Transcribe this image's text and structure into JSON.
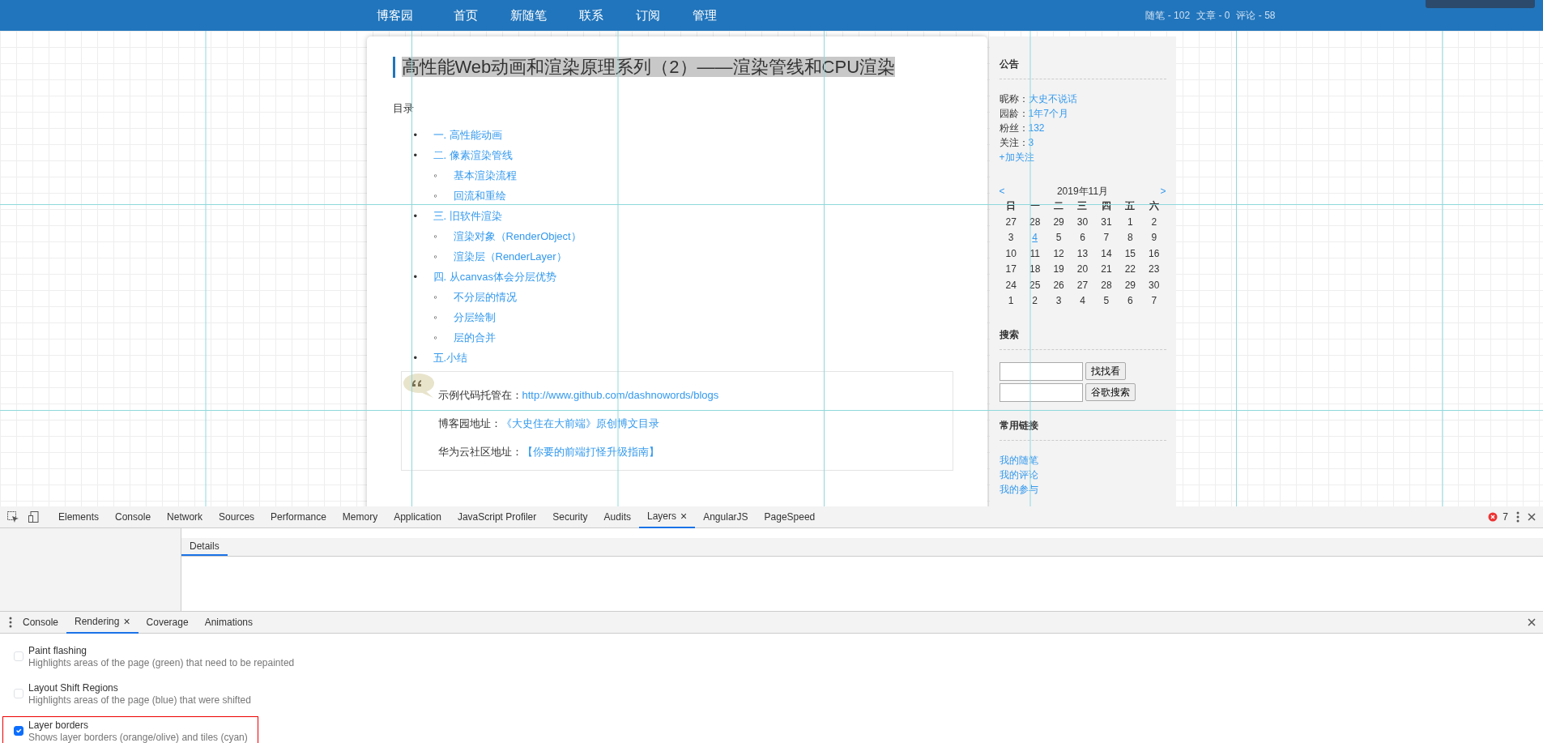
{
  "site_nav": {
    "brand": "博客园",
    "links": [
      "首页",
      "新随笔",
      "联系",
      "订阅",
      "管理"
    ],
    "stats": [
      "随笔 - 102",
      "文章 - 0",
      "评论 - 58"
    ]
  },
  "article": {
    "title": "高性能Web动画和渲染原理系列（2）——渲染管线和CPU渲染",
    "toc_label": "目录",
    "toc": [
      {
        "marker": "•",
        "text": "一. 高性能动画"
      },
      {
        "marker": "•",
        "text": "二. 像素渲染管线",
        "children": [
          {
            "marker": "◦",
            "text": "基本渲染流程"
          },
          {
            "marker": "◦",
            "text": "回流和重绘"
          }
        ]
      },
      {
        "marker": "•",
        "text": "三. 旧软件渲染",
        "children": [
          {
            "marker": "◦",
            "text": "渲染对象（RenderObject）"
          },
          {
            "marker": "◦",
            "text": "渲染层（RenderLayer）"
          }
        ]
      },
      {
        "marker": "•",
        "text": "四. 从canvas体会分层优势",
        "children": [
          {
            "marker": "◦",
            "text": "不分层的情况"
          },
          {
            "marker": "◦",
            "text": "分层绘制"
          },
          {
            "marker": "◦",
            "text": "层的合并"
          }
        ]
      },
      {
        "marker": "•",
        "text": "五.小结"
      }
    ],
    "quote": [
      {
        "label": "示例代码托管在：",
        "link": "http://www.github.com/dashnowords/blogs"
      },
      {
        "label": "博客园地址：",
        "link": "《大史住在大前端》原创博文目录"
      },
      {
        "label": "华为云社区地址：",
        "link": "【你要的前端打怪升级指南】"
      }
    ]
  },
  "sidebar": {
    "notice_heading": "公告",
    "profile": [
      {
        "label": "昵称：",
        "value": "大史不说话"
      },
      {
        "label": "园龄：",
        "value": "1年7个月"
      },
      {
        "label": "粉丝：",
        "value": "132"
      },
      {
        "label": "关注：",
        "value": "3"
      }
    ],
    "follow": "+加关注",
    "calendar": {
      "title": "2019年11月",
      "prev": "<",
      "next": ">",
      "weekdays": [
        "日",
        "一",
        "二",
        "三",
        "四",
        "五",
        "六"
      ],
      "weeks": [
        [
          {
            "day": "27",
            "linked": false
          },
          {
            "day": "28",
            "linked": false
          },
          {
            "day": "29",
            "linked": false
          },
          {
            "day": "30",
            "linked": false
          },
          {
            "day": "31",
            "linked": false
          },
          {
            "day": "1",
            "linked": false
          },
          {
            "day": "2",
            "linked": false
          }
        ],
        [
          {
            "day": "3",
            "linked": false
          },
          {
            "day": "4",
            "linked": true
          },
          {
            "day": "5",
            "linked": false
          },
          {
            "day": "6",
            "linked": false
          },
          {
            "day": "7",
            "linked": false
          },
          {
            "day": "8",
            "linked": false
          },
          {
            "day": "9",
            "linked": false
          }
        ],
        [
          {
            "day": "10",
            "linked": false
          },
          {
            "day": "11",
            "linked": false
          },
          {
            "day": "12",
            "linked": false
          },
          {
            "day": "13",
            "linked": false
          },
          {
            "day": "14",
            "linked": false
          },
          {
            "day": "15",
            "linked": false
          },
          {
            "day": "16",
            "linked": false
          }
        ],
        [
          {
            "day": "17",
            "linked": false
          },
          {
            "day": "18",
            "linked": false
          },
          {
            "day": "19",
            "linked": false
          },
          {
            "day": "20",
            "linked": false
          },
          {
            "day": "21",
            "linked": false
          },
          {
            "day": "22",
            "linked": false
          },
          {
            "day": "23",
            "linked": false
          }
        ],
        [
          {
            "day": "24",
            "linked": false
          },
          {
            "day": "25",
            "linked": false
          },
          {
            "day": "26",
            "linked": false
          },
          {
            "day": "27",
            "linked": false
          },
          {
            "day": "28",
            "linked": false
          },
          {
            "day": "29",
            "linked": false
          },
          {
            "day": "30",
            "linked": false
          }
        ],
        [
          {
            "day": "1",
            "linked": false
          },
          {
            "day": "2",
            "linked": false
          },
          {
            "day": "3",
            "linked": false
          },
          {
            "day": "4",
            "linked": false
          },
          {
            "day": "5",
            "linked": false
          },
          {
            "day": "6",
            "linked": false
          },
          {
            "day": "7",
            "linked": false
          }
        ]
      ]
    },
    "search_heading": "搜索",
    "search_buttons": [
      "找找看",
      "谷歌搜索"
    ],
    "links_heading": "常用链接",
    "links": [
      "我的随笔",
      "我的评论",
      "我的参与"
    ]
  },
  "devtools": {
    "tabs": [
      {
        "label": "Elements",
        "selected": false
      },
      {
        "label": "Console",
        "selected": false
      },
      {
        "label": "Network",
        "selected": false
      },
      {
        "label": "Sources",
        "selected": false
      },
      {
        "label": "Performance",
        "selected": false
      },
      {
        "label": "Memory",
        "selected": false
      },
      {
        "label": "Application",
        "selected": false
      },
      {
        "label": "JavaScript Profiler",
        "selected": false
      },
      {
        "label": "Security",
        "selected": false
      },
      {
        "label": "Audits",
        "selected": false
      },
      {
        "label": "Layers",
        "selected": true,
        "close_label": "×"
      },
      {
        "label": "AngularJS",
        "selected": false
      },
      {
        "label": "PageSpeed",
        "selected": false
      }
    ],
    "error_count": "7",
    "layers_tabs": [
      {
        "label": "Details",
        "selected": true
      }
    ],
    "drawer_tabs": [
      {
        "label": "Console",
        "selected": false
      },
      {
        "label": "Rendering",
        "selected": true,
        "close_label": "×"
      },
      {
        "label": "Coverage",
        "selected": false
      },
      {
        "label": "Animations",
        "selected": false
      }
    ],
    "options": [
      {
        "title": "Paint flashing",
        "description": "Highlights areas of the page (green) that need to be repainted",
        "checked": false,
        "highlighted": false
      },
      {
        "title": "Layout Shift Regions",
        "description": "Highlights areas of the page (blue) that were shifted",
        "checked": false,
        "highlighted": false
      },
      {
        "title": "Layer borders",
        "description": "Shows layer borders (orange/olive) and tiles (cyan)",
        "checked": true,
        "highlighted": true
      }
    ]
  }
}
